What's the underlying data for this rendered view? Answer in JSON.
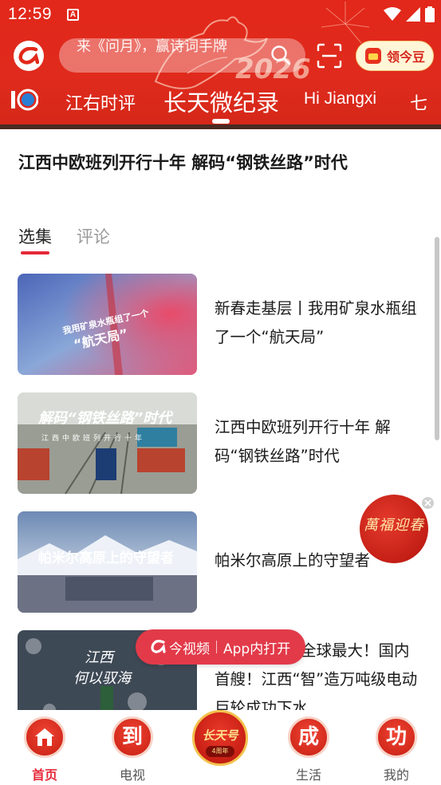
{
  "status_bar": {
    "time": "12:59",
    "notification_icon_letter": "A"
  },
  "header": {
    "search": {
      "placeholder": "来《问月》，赢诗词手牌"
    },
    "decoration_text": "2026",
    "coins_button": {
      "label": "领今豆"
    },
    "channels": [
      {
        "label": "江右时评",
        "active": false
      },
      {
        "label": "长天微纪录",
        "active": true
      },
      {
        "label": "Hi Jiangxi",
        "active": false
      },
      {
        "label": "七",
        "active": false
      }
    ]
  },
  "video": {
    "title": "江西中欧班列开行十年 解码“钢铁丝路”时代"
  },
  "tabs": [
    {
      "label": "选集",
      "active": true
    },
    {
      "label": "评论",
      "active": false
    }
  ],
  "episodes": [
    {
      "title": "新春走基层丨我用矿泉水瓶组了一个“航天局”",
      "thumb_caption_1": "我用矿泉水瓶组了一个",
      "thumb_caption_2": "“航天局”"
    },
    {
      "title": "江西中欧班列开行十年 解码“钢铁丝路”时代",
      "thumb_caption_1": "解码“钢铁丝路”时代",
      "thumb_caption_2": "江西中欧班列开行十年"
    },
    {
      "title": "帕米尔高原上的守望者",
      "thumb_caption_1": "帕米尔高原上的守望者",
      "thumb_caption_2": ""
    },
    {
      "title": "全球最大！国内首艘！江西“智”造万吨级电动巨轮成功下水",
      "title_visible": "全球最大！国内首艘！江西“智”造万吨级电动巨轮成功下水",
      "thumb_caption_1": "江西",
      "thumb_caption_2": "何以驭海"
    }
  ],
  "floating_badge": {
    "text": "萬福迎春"
  },
  "open_app": {
    "brand": "今视频",
    "action": "App内打开"
  },
  "bottom_nav": {
    "items": [
      {
        "label": "首页",
        "glyph": "home",
        "active": true
      },
      {
        "label": "电视",
        "glyph": "到",
        "active": false
      },
      {
        "label": "",
        "glyph": "长天号",
        "badge": "4周年",
        "center": true
      },
      {
        "label": "生活",
        "glyph": "成",
        "active": false
      },
      {
        "label": "我的",
        "glyph": "功",
        "active": false
      }
    ]
  },
  "colors": {
    "header_red": "#e2281a",
    "accent": "#e5293a",
    "open_app_pill": "#e23a49",
    "coin_text": "#d6281b"
  }
}
